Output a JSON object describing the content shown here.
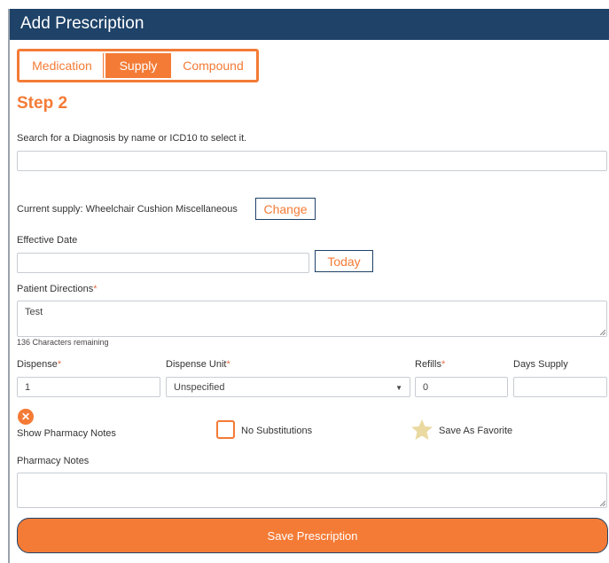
{
  "window": {
    "title": "Add Prescription"
  },
  "tabs": [
    {
      "label": "Medication",
      "active": false
    },
    {
      "label": "Supply",
      "active": true
    },
    {
      "label": "Compound",
      "active": false
    }
  ],
  "step": {
    "title": "Step 2"
  },
  "diagnosis": {
    "label": "Search for a Diagnosis by name or ICD10 to select it.",
    "value": ""
  },
  "current_supply": {
    "label": "Current supply: Wheelchair Cushion Miscellaneous",
    "change_label": "Change"
  },
  "effective_date": {
    "label": "Effective Date",
    "value": "",
    "today_label": "Today"
  },
  "patient_directions": {
    "label": "Patient Directions",
    "required_mark": "*",
    "value": "Test",
    "chars_remaining": "136 Characters remaining"
  },
  "dispense": {
    "label": "Dispense",
    "required_mark": "*",
    "value": "1"
  },
  "dispense_unit": {
    "label": "Dispense Unit",
    "required_mark": "*",
    "value": "Unspecified",
    "arrow": "▼"
  },
  "refills": {
    "label": "Refills",
    "required_mark": "*",
    "value": "0"
  },
  "days_supply": {
    "label": "Days Supply",
    "value": ""
  },
  "pharmacy_notes_toggle": {
    "label": "Show Pharmacy Notes",
    "icon": "close-circle-icon",
    "glyph": "✕"
  },
  "no_substitutions": {
    "label": "No Substitutions",
    "checked": false
  },
  "favorite": {
    "label": "Save As Favorite",
    "icon": "star-icon"
  },
  "pharmacy_notes": {
    "label": "Pharmacy Notes",
    "value": ""
  },
  "save": {
    "label": "Save Prescription"
  },
  "colors": {
    "accent": "#f47b36",
    "header": "#1e4268",
    "required": "#e0704a",
    "star": "#ead9a0"
  }
}
